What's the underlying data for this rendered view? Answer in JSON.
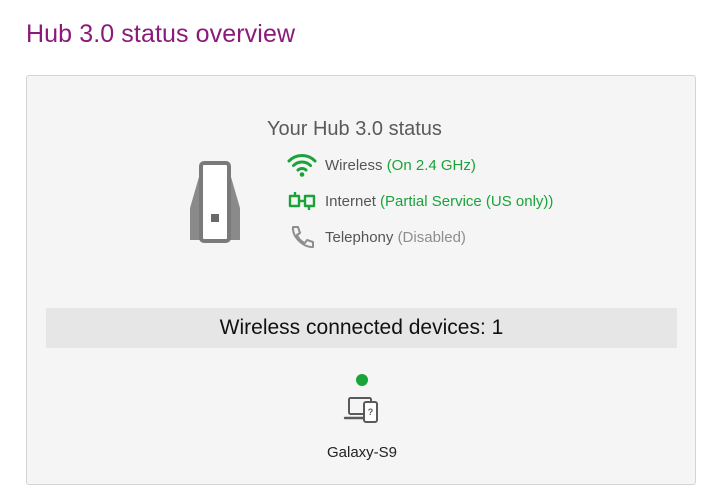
{
  "page": {
    "title": "Hub 3.0 status overview"
  },
  "status": {
    "title": "Your Hub 3.0 status",
    "items": [
      {
        "label": "Wireless",
        "value": "(On 2.4 GHz)",
        "state": "ok",
        "icon": "wifi-icon"
      },
      {
        "label": "Internet",
        "value": "(Partial Service (US only))",
        "state": "ok",
        "icon": "internet-plug-icon"
      },
      {
        "label": "Telephony",
        "value": "(Disabled)",
        "state": "disabled",
        "icon": "phone-icon"
      }
    ]
  },
  "devices": {
    "header": "Wireless connected devices: 1",
    "list": [
      {
        "name": "Galaxy-S9",
        "status": "connected",
        "icon": "device-icon"
      }
    ]
  },
  "colors": {
    "brand": "#8b1a7a",
    "ok": "#1aa33a",
    "disabled": "#8e8e8e"
  }
}
